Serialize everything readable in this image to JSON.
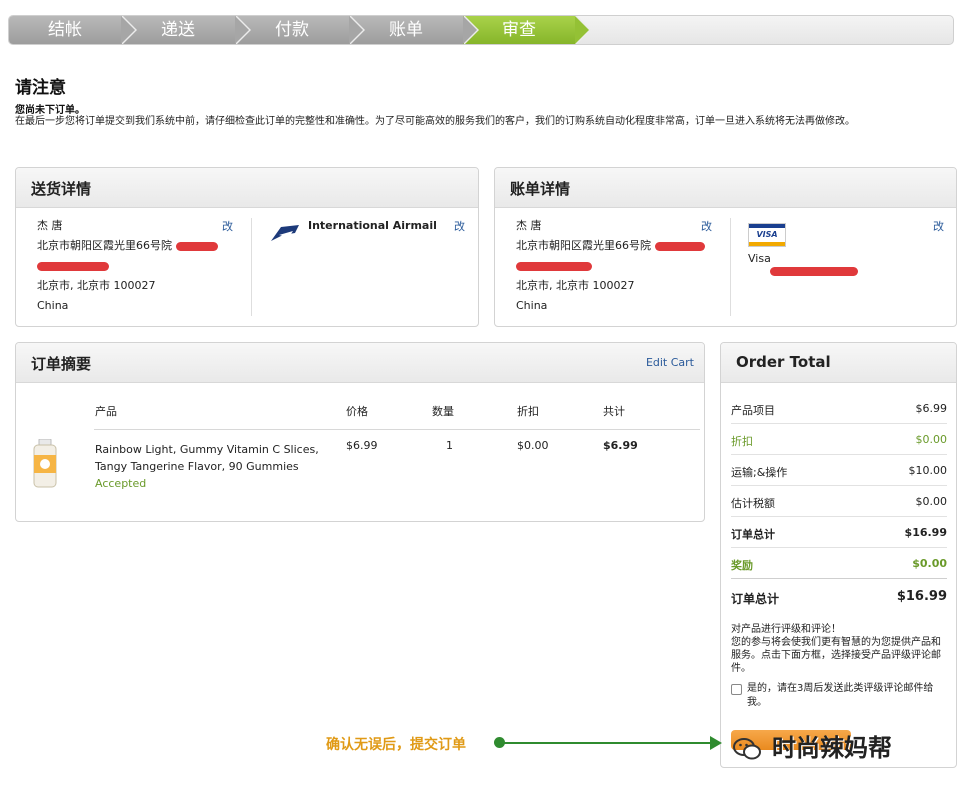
{
  "steps": [
    "结帐",
    "递送",
    "付款",
    "账单",
    "审查"
  ],
  "notice": {
    "title": "请注意",
    "subtitle": "您尚未下订单。",
    "text": "在最后一步您将订单提交到我们系统中前，请仔细检查此订单的完整性和准确性。为了尽可能高效的服务我们的客户，我们的订购系统自动化程度非常高，订单一旦进入系统将无法再做修改。"
  },
  "shipping": {
    "title": "送货详情",
    "name": "杰 唐",
    "address_line1": "北京市朝阳区霞光里66号院",
    "city_line": "北京市, 北京市 100027",
    "country": "China",
    "edit_label": "改",
    "method": "International Airmail",
    "method_edit_label": "改"
  },
  "billing": {
    "title": "账单详情",
    "name": "杰 唐",
    "address_line1": "北京市朝阳区霞光里66号院",
    "city_line": "北京市, 北京市 100027",
    "country": "China",
    "edit_label": "改",
    "card_brand": "VISA",
    "card_label": "Visa",
    "card_edit_label": "改"
  },
  "order_summary": {
    "title": "订单摘要",
    "edit_cart_label": "Edit Cart",
    "columns": [
      "产品",
      "价格",
      "数量",
      "折扣",
      "共计"
    ],
    "items": [
      {
        "name_line1": "Rainbow Light, Gummy Vitamin C Slices,",
        "name_line2": "Tangy Tangerine Flavor, 90 Gummies",
        "status": "Accepted",
        "price": "$6.99",
        "qty": "1",
        "discount": "$0.00",
        "total": "$6.99"
      }
    ]
  },
  "order_total": {
    "title": "Order Total",
    "rows": [
      {
        "label": "产品项目",
        "value": "$6.99"
      },
      {
        "label": "折扣",
        "value": "$0.00"
      },
      {
        "label": "运输;&操作",
        "value": "$10.00"
      },
      {
        "label": "估计税额",
        "value": "$0.00"
      },
      {
        "label": "订单总计",
        "value": "$16.99"
      },
      {
        "label": "奖励",
        "value": "$0.00"
      }
    ],
    "grand_label": "订单总计",
    "grand_value": "$16.99",
    "review_title": "对产品进行评级和评论！",
    "review_text": "您的参与将会使我们更有智慧的为您提供产品和服务。点击下面方框，选择接受产品评级评论邮件。",
    "checkbox_label": "是的，请在3周后发送此类评级评论邮件给我。"
  },
  "callout": "确认无误后，提交订单",
  "watermark": "时尚辣妈帮",
  "colors": {
    "step_active": "#94c135",
    "step_done": "#a6a6a6",
    "accent_link": "#2a5a9a",
    "green": "#6a9a2a",
    "submit": "#e98a1f",
    "redaction": "#e0393b"
  }
}
